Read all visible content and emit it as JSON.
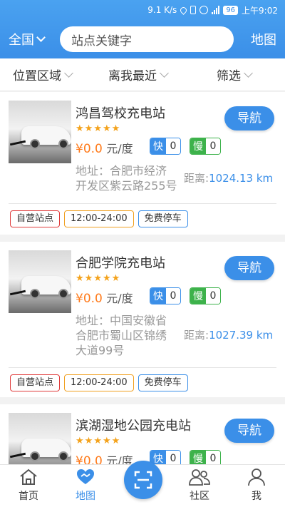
{
  "status_bar": {
    "speed": "9.1 K/s",
    "battery": "96",
    "time": "上午9:02"
  },
  "header": {
    "city": "全国",
    "search_placeholder": "站点关键字",
    "map_label": "地图"
  },
  "filters": [
    {
      "label": "位置区域"
    },
    {
      "label": "离我最近"
    },
    {
      "label": "筛选"
    }
  ],
  "stations": [
    {
      "name": "鸿昌驾校充电站",
      "rating": 5,
      "price": "¥0.0",
      "price_unit": "元/度",
      "fast_label": "快",
      "fast_count": "0",
      "slow_label": "慢",
      "slow_count": "0",
      "nav_label": "导航",
      "address_lines": [
        "地址：合肥市经济",
        "开发区紫云路255号"
      ],
      "distance_label": "距离:",
      "distance_value": "1024.13 km",
      "tags": [
        "自营站点",
        "12:00-24:00",
        "免费停车"
      ]
    },
    {
      "name": "合肥学院充电站",
      "rating": 5,
      "price": "¥0.0",
      "price_unit": "元/度",
      "fast_label": "快",
      "fast_count": "0",
      "slow_label": "慢",
      "slow_count": "0",
      "nav_label": "导航",
      "address_lines": [
        "地址：中国安徽省",
        "合肥市蜀山区锦绣",
        "大道99号"
      ],
      "distance_label": "距离:",
      "distance_value": "1027.39 km",
      "tags": [
        "自营站点",
        "12:00-24:00",
        "免费停车"
      ]
    },
    {
      "name": "滨湖湿地公园充电站",
      "rating": 5,
      "price": "¥0.0",
      "price_unit": "元/度",
      "fast_label": "快",
      "fast_count": "0",
      "slow_label": "慢",
      "slow_count": "0",
      "nav_label": "导航"
    }
  ],
  "bottom_nav": [
    {
      "label": "首页",
      "icon": "home-icon"
    },
    {
      "label": "地图",
      "icon": "heart-map-icon",
      "active": true
    },
    {
      "label": "",
      "icon": "scan-icon"
    },
    {
      "label": "社区",
      "icon": "community-icon"
    },
    {
      "label": "我",
      "icon": "user-icon"
    }
  ],
  "colors": {
    "accent": "#3b8fe8",
    "price": "#ff7a1a",
    "star": "#f4a21b",
    "fast": "#3b8fe8",
    "slow": "#3db24b"
  }
}
